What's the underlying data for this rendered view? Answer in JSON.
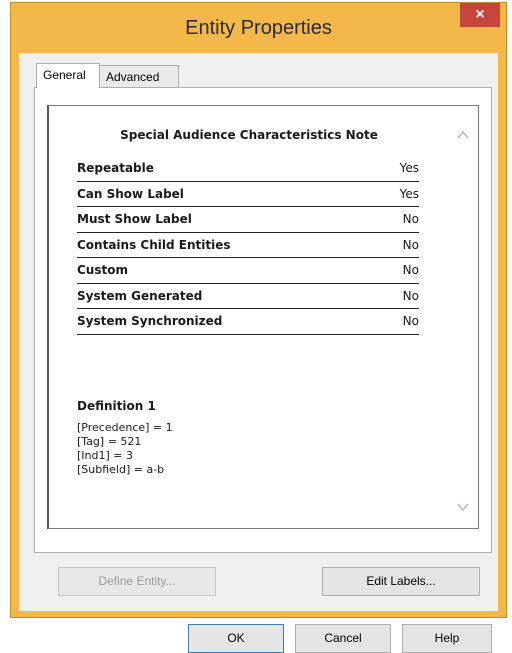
{
  "window": {
    "title": "Entity Properties",
    "close_label": "×"
  },
  "tabs": [
    {
      "label": "General",
      "active": true
    },
    {
      "label": "Advanced",
      "active": false
    }
  ],
  "content": {
    "heading": "Special Audience Characteristics Note",
    "properties": [
      {
        "label": "Repeatable",
        "value": "Yes"
      },
      {
        "label": "Can Show Label",
        "value": "Yes"
      },
      {
        "label": "Must Show Label",
        "value": "No"
      },
      {
        "label": "Contains Child Entities",
        "value": "No"
      },
      {
        "label": "Custom",
        "value": "No"
      },
      {
        "label": "System Generated",
        "value": "No"
      },
      {
        "label": "System Synchronized",
        "value": "No"
      }
    ],
    "definition": {
      "title": "Definition 1",
      "lines": [
        "[Precedence] = 1",
        "[Tag] = 521",
        "[Ind1] = 3",
        "[Subfield] = a-b"
      ]
    }
  },
  "buttons": {
    "define_entity": "Define Entity...",
    "edit_labels": "Edit Labels...",
    "ok": "OK",
    "cancel": "Cancel",
    "help": "Help"
  },
  "icons": {
    "scroll_up": "chevron-up-icon",
    "scroll_down": "chevron-down-icon",
    "close": "close-icon"
  },
  "colors": {
    "title_bar": "#f3b74a",
    "close_button": "#c7463c",
    "dialog_bg": "#f0f0f0"
  }
}
